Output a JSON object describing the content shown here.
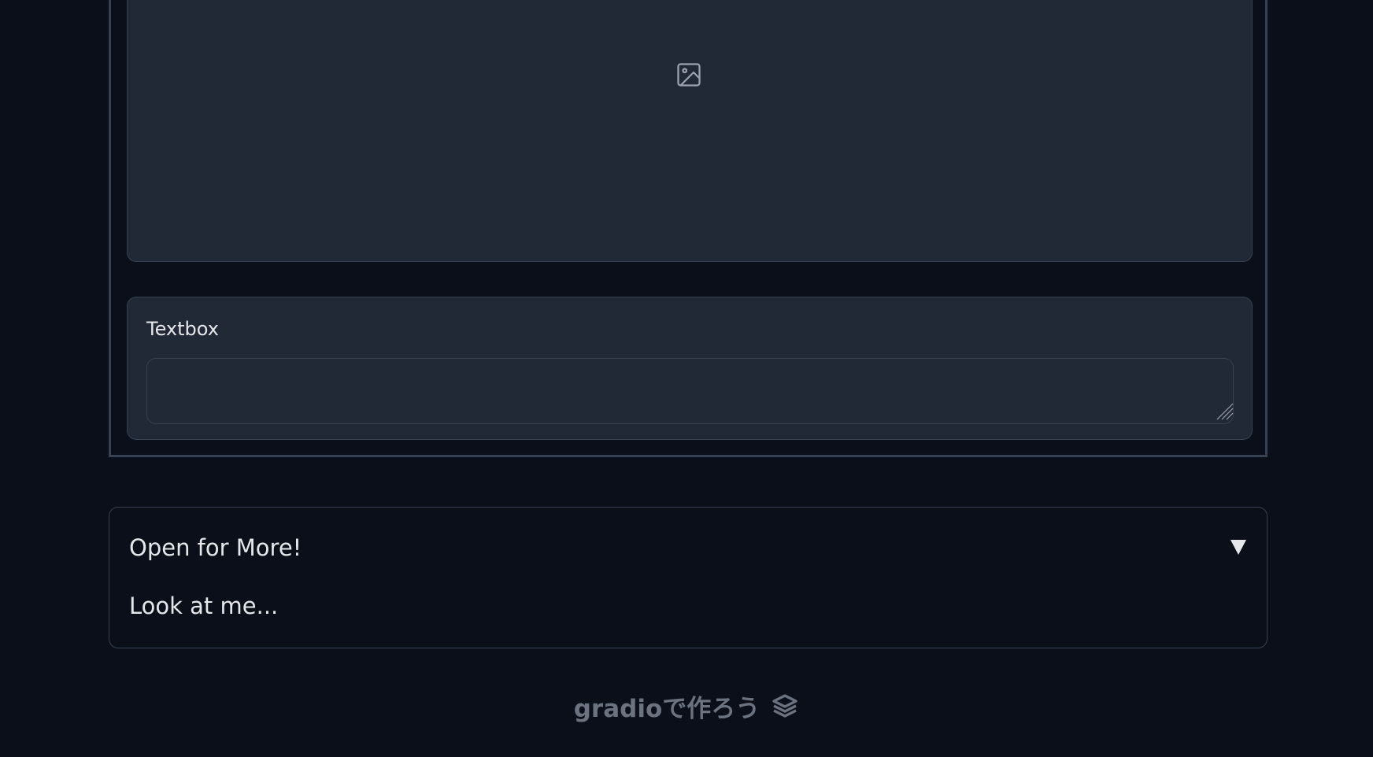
{
  "image_panel": {
    "icon": "image-icon"
  },
  "textbox": {
    "label": "Textbox",
    "value": "",
    "placeholder": ""
  },
  "accordion": {
    "title": "Open for More!",
    "arrow_icon": "triangle-down-icon",
    "body": "Look at me..."
  },
  "footer": {
    "link_text": "gradioで作ろう",
    "logo_icon": "gradio-logo-icon"
  },
  "colors": {
    "background": "#0b0f19",
    "panel": "#212836",
    "border": "#374151",
    "text": "#e5e7eb",
    "muted": "#6b7280"
  }
}
